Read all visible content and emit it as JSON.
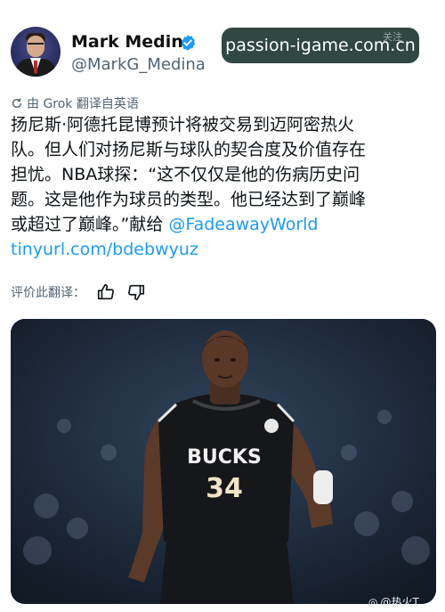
{
  "author": {
    "name": "Mark Medina",
    "handle": "@MarkG_Medina",
    "verified_color": "#1d9bf0"
  },
  "overlay": {
    "site": "passion-igame.com.cn",
    "follow_faint": "关注"
  },
  "translation": {
    "label": "由 Grok 翻译自英语",
    "icon": "translate-icon"
  },
  "tweet": {
    "line1": "扬尼斯·阿德托昆博预计将被交易到迈阿密热火",
    "line2": "队。但人们对扬尼斯与球队的契合度及价值存在",
    "line3": "担忧。NBA球探：“这不仅仅是他的伤病历史问",
    "line4": "题。这是他作为球员的类型。他已经达到了巅峰",
    "line5_prefix": "或超过了巅峰。”献给 ",
    "mention": "@FadeawayWorld",
    "url": "tinyurl.com/bdebwyuz",
    "link_color": "#1d9bf0"
  },
  "rating": {
    "label": "评价此翻译：",
    "thumbs_up": "thumbs-up-icon",
    "thumbs_down": "thumbs-down-icon"
  },
  "photo": {
    "jersey_team": "BUCKS",
    "jersey_number": "34"
  },
  "source_watermark": "@热火T"
}
